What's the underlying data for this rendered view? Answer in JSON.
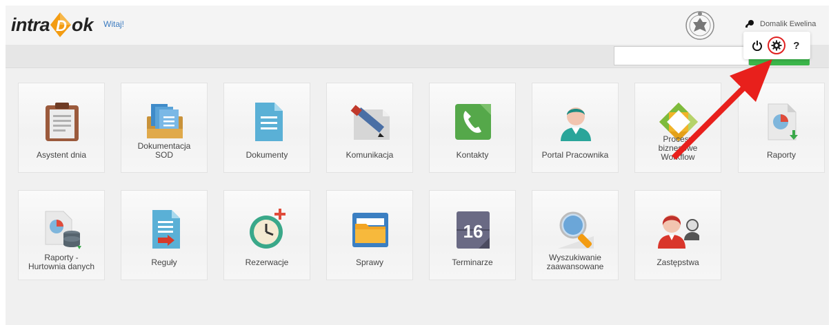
{
  "header": {
    "logo_part1": "intra",
    "logo_part2": "ok",
    "welcome": "Witaj!",
    "user_name": "Domalik Ewelina"
  },
  "user_menu": {
    "help_label": "?"
  },
  "search": {
    "value": "",
    "placeholder": ""
  },
  "tiles": [
    {
      "label": "Asystent dnia",
      "icon": "clipboard-icon"
    },
    {
      "label": "Dokumentacja\nSOD",
      "icon": "document-folder-icon"
    },
    {
      "label": "Dokumenty",
      "icon": "document-icon"
    },
    {
      "label": "Komunikacja",
      "icon": "pencil-note-icon"
    },
    {
      "label": "Kontakty",
      "icon": "phone-icon"
    },
    {
      "label": "Portal Pracownika",
      "icon": "person-icon"
    },
    {
      "label": "Procesy\nbiznesowe\nWorkflow",
      "icon": "workflow-icon"
    },
    {
      "label": "Raporty",
      "icon": "report-chart-icon"
    },
    {
      "label": "Raporty -\nHurtownia danych",
      "icon": "report-database-icon"
    },
    {
      "label": "Reguły",
      "icon": "rules-document-icon"
    },
    {
      "label": "Rezerwacje",
      "icon": "alarm-clock-icon"
    },
    {
      "label": "Sprawy",
      "icon": "folder-icon"
    },
    {
      "label": "Terminarze",
      "icon": "calendar-icon",
      "day": "16"
    },
    {
      "label": "Wyszukiwanie\nzaawansowane",
      "icon": "magnifier-icon"
    },
    {
      "label": "Zastępstwa",
      "icon": "substitute-persons-icon"
    }
  ],
  "colors": {
    "accent_orange": "#f39c12",
    "link_blue": "#3a7abf",
    "search_green": "#3bb54a",
    "annotation_red": "#e8201c"
  }
}
